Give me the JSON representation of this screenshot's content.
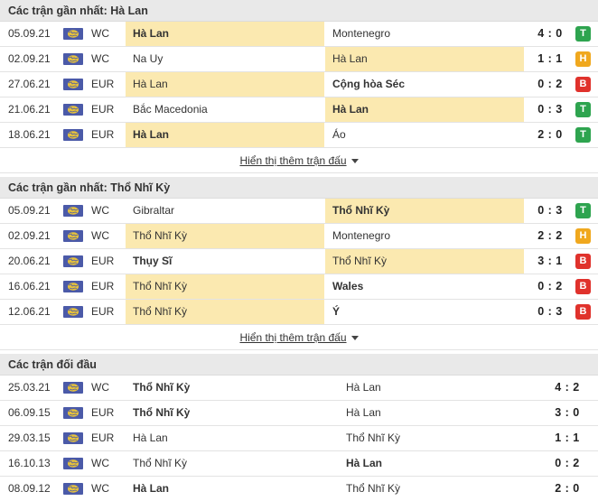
{
  "sections": [
    {
      "title": "Các trận gần nhất: Hà Lan",
      "matches": [
        {
          "date": "05.09.21",
          "comp": "WC",
          "home": "Hà Lan",
          "away": "Montenegro",
          "score": "4 : 0",
          "result": "T",
          "hl": "home",
          "bold": "home"
        },
        {
          "date": "02.09.21",
          "comp": "WC",
          "home": "Na Uy",
          "away": "Hà Lan",
          "score": "1 : 1",
          "result": "H",
          "hl": "away",
          "bold": ""
        },
        {
          "date": "27.06.21",
          "comp": "EUR",
          "home": "Hà Lan",
          "away": "Cộng hòa Séc",
          "score": "0 : 2",
          "result": "B",
          "hl": "home",
          "bold": "away"
        },
        {
          "date": "21.06.21",
          "comp": "EUR",
          "home": "Bắc Macedonia",
          "away": "Hà Lan",
          "score": "0 : 3",
          "result": "T",
          "hl": "away",
          "bold": "away"
        },
        {
          "date": "18.06.21",
          "comp": "EUR",
          "home": "Hà Lan",
          "away": "Áo",
          "score": "2 : 0",
          "result": "T",
          "hl": "home",
          "bold": "home"
        }
      ],
      "more": "Hiển thị thêm trận đấu"
    },
    {
      "title": "Các trận gần nhất: Thổ Nhĩ Kỳ",
      "matches": [
        {
          "date": "05.09.21",
          "comp": "WC",
          "home": "Gibraltar",
          "away": "Thổ Nhĩ Kỳ",
          "score": "0 : 3",
          "result": "T",
          "hl": "away",
          "bold": "away"
        },
        {
          "date": "02.09.21",
          "comp": "WC",
          "home": "Thổ Nhĩ Kỳ",
          "away": "Montenegro",
          "score": "2 : 2",
          "result": "H",
          "hl": "home",
          "bold": ""
        },
        {
          "date": "20.06.21",
          "comp": "EUR",
          "home": "Thụy Sĩ",
          "away": "Thổ Nhĩ Kỳ",
          "score": "3 : 1",
          "result": "B",
          "hl": "away",
          "bold": "home"
        },
        {
          "date": "16.06.21",
          "comp": "EUR",
          "home": "Thổ Nhĩ Kỳ",
          "away": "Wales",
          "score": "0 : 2",
          "result": "B",
          "hl": "home",
          "bold": "away"
        },
        {
          "date": "12.06.21",
          "comp": "EUR",
          "home": "Thổ Nhĩ Kỳ",
          "away": "Ý",
          "score": "0 : 3",
          "result": "B",
          "hl": "home",
          "bold": "away"
        }
      ],
      "more": "Hiển thị thêm trận đấu"
    }
  ],
  "h2h": {
    "title": "Các trận đối đầu",
    "matches": [
      {
        "date": "25.03.21",
        "comp": "WC",
        "home": "Thổ Nhĩ Kỳ",
        "away": "Hà Lan",
        "score": "4 : 2",
        "bold": "home"
      },
      {
        "date": "06.09.15",
        "comp": "EUR",
        "home": "Thổ Nhĩ Kỳ",
        "away": "Hà Lan",
        "score": "3 : 0",
        "bold": "home"
      },
      {
        "date": "29.03.15",
        "comp": "EUR",
        "home": "Hà Lan",
        "away": "Thổ Nhĩ Kỳ",
        "score": "1 : 1",
        "bold": ""
      },
      {
        "date": "16.10.13",
        "comp": "WC",
        "home": "Thổ Nhĩ Kỳ",
        "away": "Hà Lan",
        "score": "0 : 2",
        "bold": "away"
      },
      {
        "date": "08.09.12",
        "comp": "WC",
        "home": "Hà Lan",
        "away": "Thổ Nhĩ Kỳ",
        "score": "2 : 0",
        "bold": "home"
      }
    ]
  },
  "icons": {
    "competition": "world-flag-icon",
    "more": "caret-down-icon"
  },
  "colors": {
    "win": "#2ea44f",
    "draw": "#f0a81e",
    "loss": "#e0322c",
    "highlight": "#fbe9b0",
    "header_bg": "#e9e9e9"
  }
}
